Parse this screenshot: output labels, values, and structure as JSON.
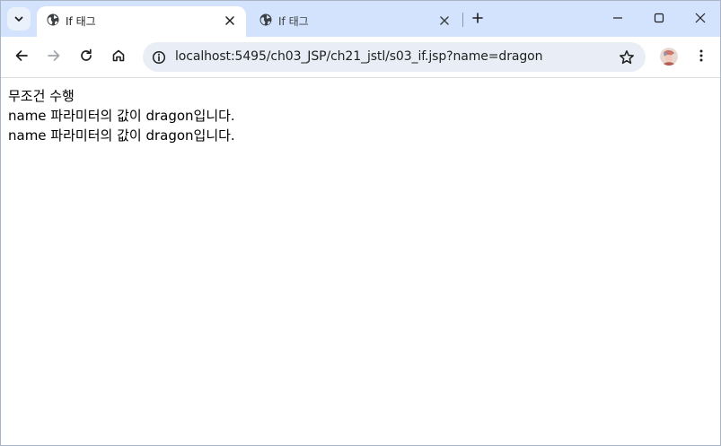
{
  "tabs": [
    {
      "title": "If 태그",
      "active": true
    },
    {
      "title": "If 태그",
      "active": false
    }
  ],
  "toolbar": {
    "url": "localhost:5495/ch03_JSP/ch21_jstl/s03_if.jsp?name=dragon"
  },
  "icons": {
    "tab_search": "chevron-down-icon",
    "favicon": "globe-icon",
    "close": "close-icon",
    "new_tab": "plus-icon",
    "minimize": "minimize-icon",
    "maximize": "maximize-icon",
    "window_close": "window-close-icon",
    "back": "back-arrow-icon",
    "forward": "forward-arrow-icon",
    "reload": "reload-icon",
    "home": "home-icon",
    "site_info": "info-icon",
    "bookmark": "star-icon",
    "profile": "avatar",
    "menu": "kebab-menu-icon"
  },
  "colors": {
    "tabstrip_bg": "#d3e3fd",
    "omnibox_bg": "#e9eef6",
    "text": "#1f1f1f"
  },
  "page": {
    "lines": [
      "무조건 수행",
      "name 파라미터의 값이 dragon입니다.",
      "name 파라미터의 값이 dragon입니다."
    ]
  }
}
